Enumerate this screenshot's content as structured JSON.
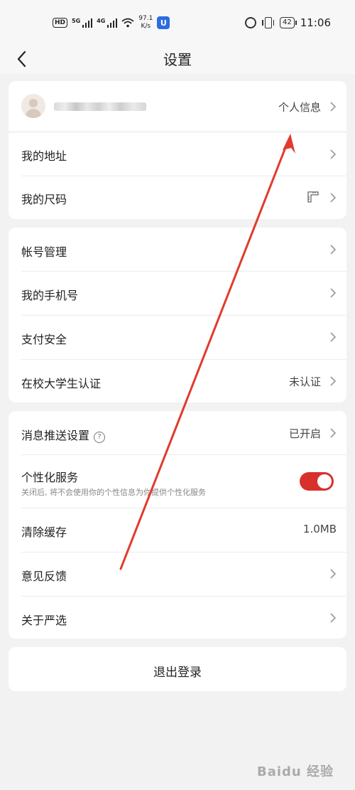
{
  "status_bar": {
    "hd": "HD",
    "sim1_tag": "5G",
    "sim2_tag": "4G",
    "speed_value": "97.1",
    "speed_unit": "K/s",
    "app_badge": "U",
    "battery": "42",
    "time": "11:06"
  },
  "nav": {
    "title": "设置"
  },
  "profile": {
    "label": "个人信息"
  },
  "section1": [
    {
      "label": "我的地址"
    },
    {
      "label": "我的尺码"
    }
  ],
  "section2": [
    {
      "label": "帐号管理",
      "value": ""
    },
    {
      "label": "我的手机号",
      "value": ""
    },
    {
      "label": "支付安全",
      "value": ""
    },
    {
      "label": "在校大学生认证",
      "value": "未认证"
    }
  ],
  "section3": {
    "push": {
      "label": "消息推送设置",
      "help": "?",
      "value": "已开启"
    },
    "personalized": {
      "label": "个性化服务",
      "sublabel": "关闭后, 将不会使用你的个性信息为你提供个性化服务",
      "enabled": true
    },
    "cache": {
      "label": "清除缓存",
      "value": "1.0MB"
    },
    "feedback": {
      "label": "意见反馈"
    },
    "about": {
      "label": "关于严选"
    }
  },
  "logout": {
    "label": "退出登录"
  },
  "watermark": "Baidu 经验",
  "colors": {
    "accent": "#d8312b",
    "background": "#f2f2f2",
    "card": "#ffffff"
  }
}
